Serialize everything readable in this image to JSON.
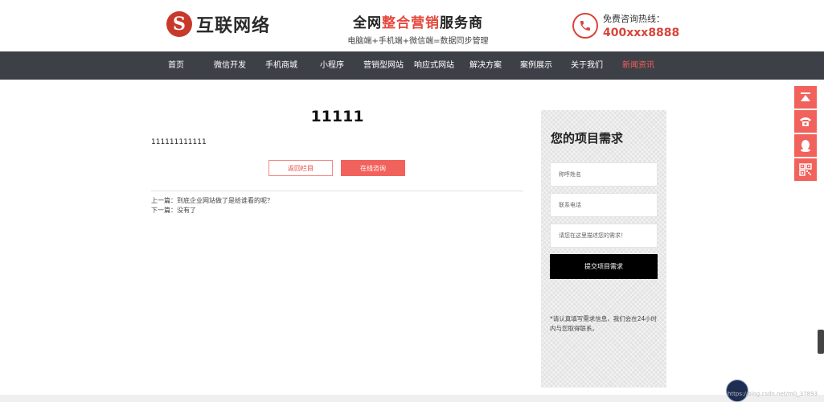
{
  "header": {
    "logo_glyph": "S",
    "logo_text": "互联网络",
    "slogan_prefix": "全网",
    "slogan_highlight": "整合营销",
    "slogan_suffix": "服务商",
    "slogan_sub": "电脑端+手机端+微信端=数据同步管理",
    "hotline_label": "免费咨询热线：",
    "hotline_number": "400xxx8888"
  },
  "nav": {
    "items": [
      {
        "label": "首页"
      },
      {
        "label": "微信开发"
      },
      {
        "label": "手机商城"
      },
      {
        "label": "小程序"
      },
      {
        "label": "营销型网站"
      },
      {
        "label": "响应式网站"
      },
      {
        "label": "解决方案"
      },
      {
        "label": "案例展示"
      },
      {
        "label": "关于我们"
      },
      {
        "label": "新闻资讯"
      }
    ],
    "active_index": 9
  },
  "article": {
    "title": "11111",
    "body": "111111111111",
    "back_button": "返回栏目",
    "consult_button": "在线咨询",
    "prev_label": "上一篇：",
    "prev_link": "到底企业网站做了是给谁看的呢？",
    "next_label": "下一篇：",
    "next_link": "没有了"
  },
  "form": {
    "title": "您的项目需求",
    "name_placeholder": "称呼姓名",
    "phone_placeholder": "联系电话",
    "need_placeholder": "请您在这里描述您的需求！",
    "submit_label": "提交项目需求",
    "note": "*请认真填写需求信息，我们会在24小时内与您取得联系。"
  },
  "float_tools": [
    {
      "icon": "back-to-top-icon"
    },
    {
      "icon": "phone-icon"
    },
    {
      "icon": "qq-icon"
    },
    {
      "icon": "qrcode-icon"
    }
  ],
  "watermark": "https://blog.csdn.net/m0_37893",
  "colors": {
    "accent": "#f2625c",
    "brand_red": "#c8392b",
    "nav_bg": "#3d4046",
    "active_nav": "#f3605b"
  }
}
